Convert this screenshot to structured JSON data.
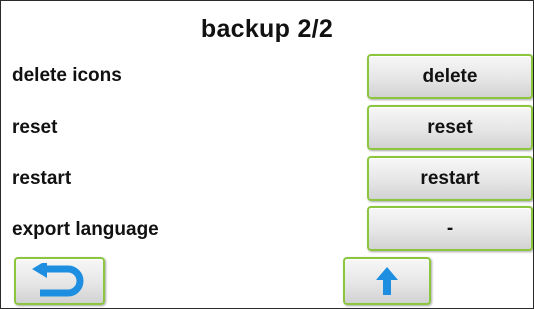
{
  "title": "backup 2/2",
  "rows": [
    {
      "label": "delete icons",
      "button": "delete"
    },
    {
      "label": "reset",
      "button": "reset"
    },
    {
      "label": "restart",
      "button": "restart"
    },
    {
      "label": "export language",
      "button": "-"
    }
  ],
  "nav": {
    "back_icon": "return-arrow-icon",
    "up_icon": "arrow-up-icon"
  },
  "colors": {
    "button_border": "#8cc63f",
    "icon_blue": "#1e8fe0",
    "background": "#ffffff"
  }
}
